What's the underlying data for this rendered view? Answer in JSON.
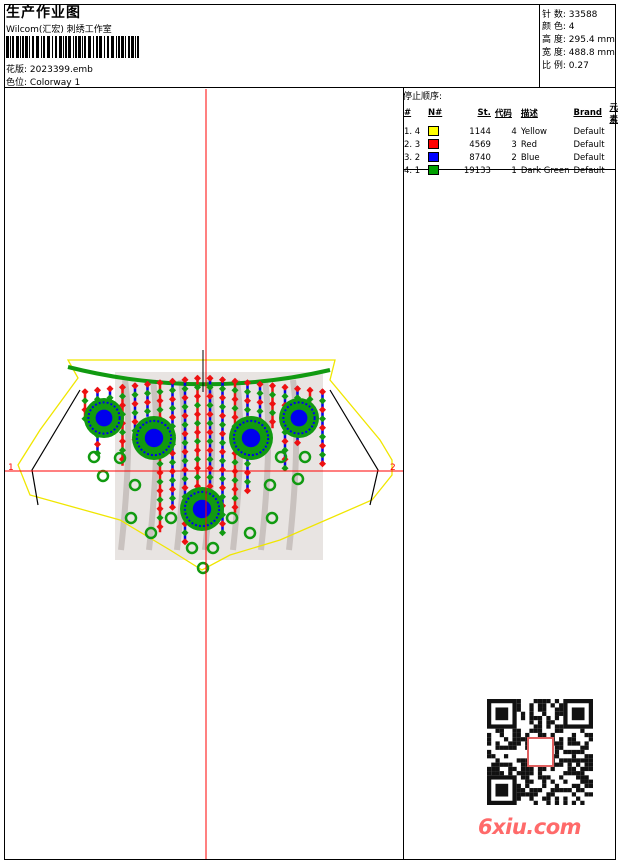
{
  "header": {
    "title": "生产作业图",
    "company": "Wilcom(汇宏) 刺绣工作室",
    "design_label": "花版:",
    "design_value": "2023399.emb",
    "colorway_label": "色位:",
    "colorway_value": "Colorway 1"
  },
  "stats": [
    {
      "label": "针 数:",
      "value": "33588"
    },
    {
      "label": "颜 色:",
      "value": "4"
    },
    {
      "label": "高 度:",
      "value": "295.4 mm"
    },
    {
      "label": "宽 度:",
      "value": "488.8 mm"
    },
    {
      "label": "比 例:",
      "value": "0.27"
    }
  ],
  "legend": {
    "title": "停止顺序:",
    "headers": [
      "#",
      "N#",
      "St.",
      "代码",
      "描述",
      "Brand",
      "元素"
    ],
    "rows": [
      {
        "seq": "1. 4",
        "swatch": "#ffff00",
        "stitches": "1144",
        "code": "4",
        "desc": "Yellow",
        "brand": "Default"
      },
      {
        "seq": "2. 3",
        "swatch": "#ff0000",
        "stitches": "4569",
        "code": "3",
        "desc": "Red",
        "brand": "Default"
      },
      {
        "seq": "3. 2",
        "swatch": "#0000ff",
        "stitches": "8740",
        "code": "2",
        "desc": "Blue",
        "brand": "Default"
      },
      {
        "seq": "4. 1",
        "swatch": "#00a000",
        "stitches": "19133",
        "code": "1",
        "desc": "Dark Green",
        "brand": "Default"
      }
    ]
  },
  "canvas": {
    "axis_left": "1",
    "axis_right": "2"
  },
  "colors": {
    "axis": "#ff0000",
    "outline": "#f0e600",
    "green": "#119a11",
    "blue": "#0000ee",
    "red": "#ee1111"
  },
  "watermark": {
    "text": "6xiu.com",
    "seal_text": "QR-logo"
  }
}
